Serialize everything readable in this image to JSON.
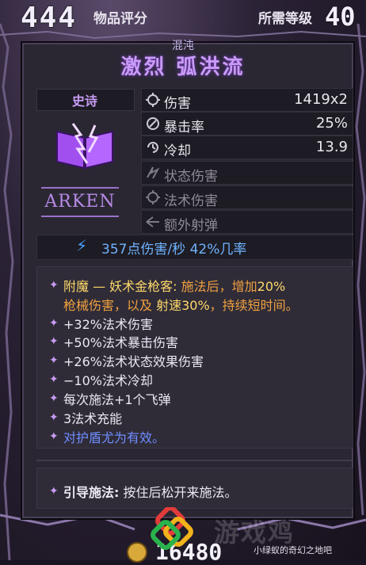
{
  "header": {
    "item_score": "444",
    "item_score_label": "物品评分",
    "required_level_label": "所需等级",
    "required_level": "40"
  },
  "item": {
    "prefix": "混沌",
    "name": "激烈 弧洪流",
    "rarity": "史诗",
    "manufacturer": "ARKEN"
  },
  "stats": [
    {
      "icon": "damage-icon",
      "label": "伤害",
      "value": "1419x2",
      "active": true
    },
    {
      "icon": "crit-icon",
      "label": "暴击率",
      "value": "25%",
      "active": true
    },
    {
      "icon": "cooldown-icon",
      "label": "冷却",
      "value": "13.9",
      "active": true
    },
    {
      "icon": "status-damage-icon",
      "label": "状态伤害",
      "value": "",
      "active": false
    },
    {
      "icon": "spell-damage-icon",
      "label": "法术伤害",
      "value": "",
      "active": false
    },
    {
      "icon": "extra-projectile-icon",
      "label": "额外射弹",
      "value": "",
      "active": false
    }
  ],
  "dps": "357点伤害/秒  42%几率",
  "effects": {
    "enchant_l1_a": "附魔 — 妖术金枪客:",
    "enchant_l1_b": " 施法后，增加",
    "enchant_l1_c": "20%",
    "enchant_l2_a": "枪械伤害，以及 ",
    "enchant_l2_b": "射速",
    "enchant_l2_c": "30%",
    "enchant_l2_d": "，持续短时间。",
    "lines": [
      "+32%法术伤害",
      "+50%法术暴击伤害",
      "+26%法术状态效果伤害",
      "−10%法术冷却",
      "每次施法+1个飞弹",
      "3法术充能"
    ],
    "shield_note": "对护盾尤为有效。"
  },
  "channel": {
    "label": "引导施法:",
    "text": " 按住后松开来施法。"
  },
  "footer": {
    "gold": "16480",
    "watermark": "游戏鸡",
    "credit": "小绿蚁的奇幻之地吧"
  },
  "colors": {
    "title": "#c99cf7",
    "enchant": "#f0a040",
    "shield_note": "#6f8cff",
    "dps": "#6fb3ff"
  }
}
